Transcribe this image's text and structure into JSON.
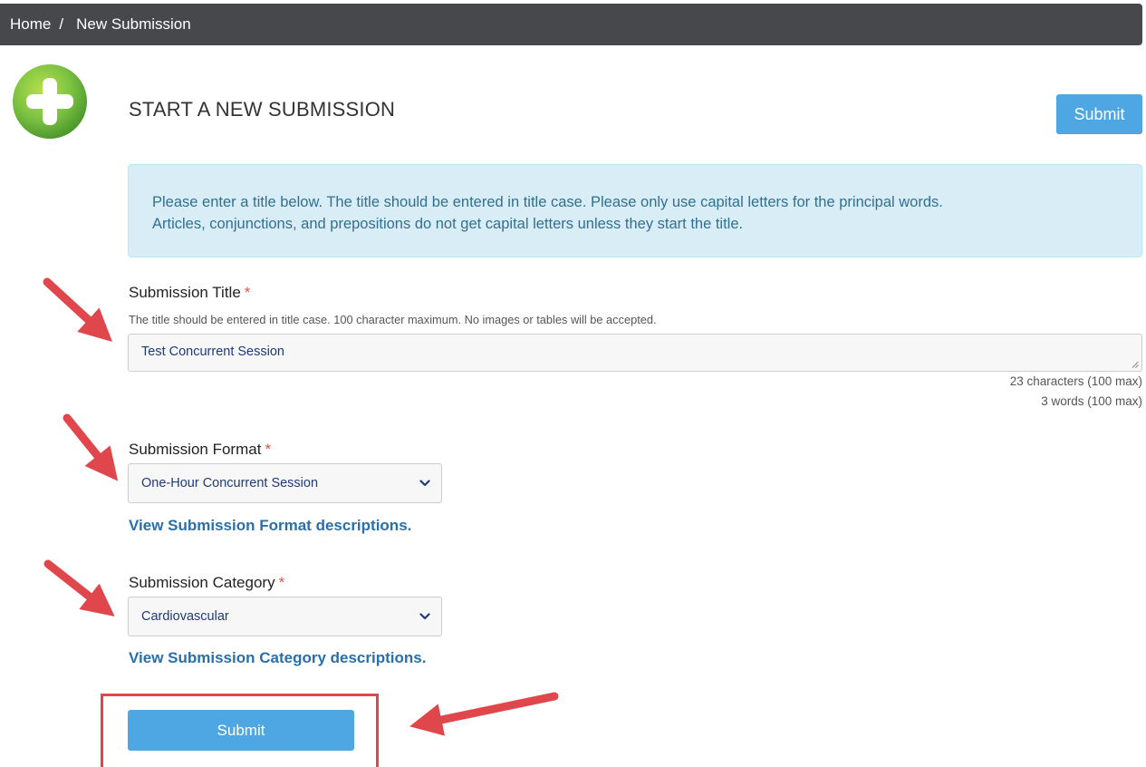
{
  "breadcrumb": {
    "home": "Home",
    "separator": "/",
    "current": "New Submission"
  },
  "header": {
    "title": "START A NEW SUBMISSION",
    "submit_label": "Submit"
  },
  "info_alert": {
    "line1": "Please enter a title below. The title should be entered in title case. Please only use capital letters for the principal words.",
    "line2": "Articles, conjunctions, and prepositions do not get capital letters unless they start the title."
  },
  "title_field": {
    "label": "Submission Title",
    "required_marker": "*",
    "help": "The title should be entered in title case. 100 character maximum. No images or tables will be accepted.",
    "value": "Test Concurrent Session",
    "char_count": "23 characters (100 max)",
    "word_count": "3 words (100 max)"
  },
  "format_field": {
    "label": "Submission Format",
    "required_marker": "*",
    "selected": "One-Hour Concurrent Session",
    "link": "View Submission Format descriptions."
  },
  "category_field": {
    "label": "Submission Category",
    "required_marker": "*",
    "selected": "Cardiovascular",
    "link": "View Submission Category descriptions."
  },
  "footer": {
    "submit_label": "Submit"
  },
  "colors": {
    "accent_blue": "#4ea6e2",
    "alert_bg": "#d9edf7",
    "annotation_red": "#e0474c",
    "breadcrumb_bg": "#46484c",
    "logo_green": "#7cc242"
  },
  "icons": {
    "logo": "plus-circle-icon",
    "select_caret": "chevron-down-icon",
    "annotation": "red-arrow-annotation"
  }
}
